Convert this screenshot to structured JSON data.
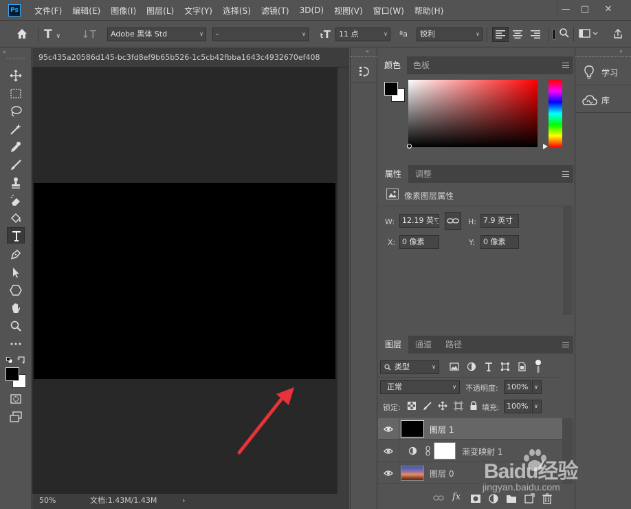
{
  "app": {
    "logo": "Ps"
  },
  "menu": [
    "文件(F)",
    "编辑(E)",
    "图像(I)",
    "图层(L)",
    "文字(Y)",
    "选择(S)",
    "滤镜(T)",
    "3D(D)",
    "视图(V)",
    "窗口(W)",
    "帮助(H)"
  ],
  "window_controls": {
    "minimize": "—",
    "maximize": "□",
    "close": "✕"
  },
  "options": {
    "font_family": "Adobe 黑体 Std",
    "font_style": "-",
    "font_size": "11 点",
    "aa_label": "ªa",
    "antialias": "锐利"
  },
  "document": {
    "tab_title": "95c435a20586d145-bc3fd8ef9b65b526-1c5cb42fbba1643c4932670ef408",
    "zoom": "50%",
    "doc_info": "文档:1.43M/1.43M",
    "status_arrow": "›",
    "canvas_color": "#000000"
  },
  "color_panel": {
    "tabs": [
      "颜色",
      "色板"
    ],
    "foreground": "#000000",
    "background": "#ffffff",
    "hue_color": "#ff0000"
  },
  "properties_panel": {
    "tabs": [
      "属性",
      "调整"
    ],
    "title": "像素图层属性",
    "w_label": "W:",
    "w_value": "12.19 英寸",
    "h_label": "H:",
    "h_value": "7.9 英寸",
    "x_label": "X:",
    "x_value": "0 像素",
    "y_label": "Y:",
    "y_value": "0 像素"
  },
  "layers_panel": {
    "tabs": [
      "图层",
      "通道",
      "路径"
    ],
    "filter_kind": "类型",
    "blend_mode": "正常",
    "opacity_label": "不透明度:",
    "opacity": "100%",
    "lock_label": "锁定:",
    "fill_label": "填充:",
    "fill": "100%",
    "layers": [
      {
        "name": "图层 1",
        "selected": true
      },
      {
        "name": "渐变映射 1",
        "selected": false
      },
      {
        "name": "图层 0",
        "selected": false
      }
    ],
    "footer_fx": "fx"
  },
  "right_column": {
    "learn_label": "学习",
    "library_label": "库"
  },
  "watermark": {
    "text": "Baidu经验",
    "url": "jingyan.baidu.com"
  },
  "annotation_arrow_color": "#e8323a"
}
